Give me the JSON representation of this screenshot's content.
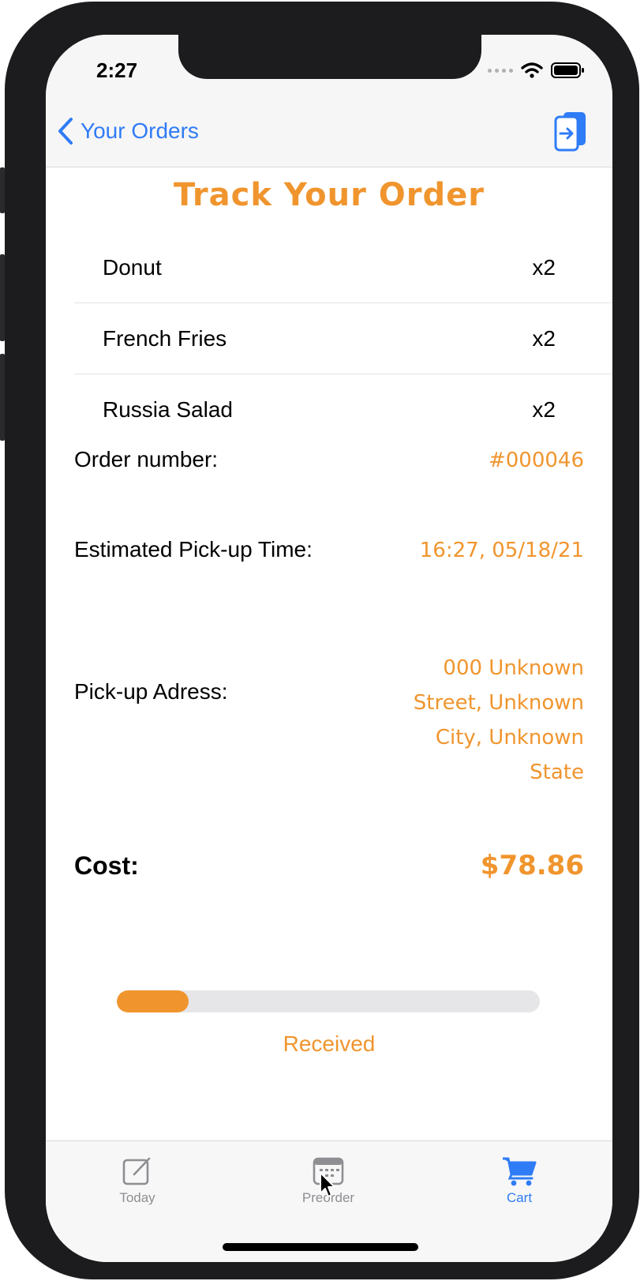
{
  "status_bar": {
    "time": "2:27"
  },
  "nav": {
    "back_label": "Your Orders"
  },
  "page": {
    "title": "Track Your Order"
  },
  "order_items": [
    {
      "name": "Donut",
      "qty": "x2"
    },
    {
      "name": "French Fries",
      "qty": "x2"
    },
    {
      "name": "Russia Salad",
      "qty": "x2"
    }
  ],
  "details": {
    "order_number_label": "Order number:",
    "order_number_value": "#000046",
    "pickup_time_label": "Estimated Pick-up Time:",
    "pickup_time_value": "16:27, 05/18/21",
    "pickup_address_label": "Pick-up Adress:",
    "pickup_address_value": "000 Unknown Street, Unknown City, Unknown State",
    "cost_label": "Cost:",
    "cost_value": "$78.86"
  },
  "progress": {
    "fraction": 0.17,
    "status": "Received"
  },
  "tabbar": {
    "tabs": [
      {
        "label": "Today",
        "icon": "compose-icon",
        "active": false
      },
      {
        "label": "Preorder",
        "icon": "calendar-icon",
        "active": false
      },
      {
        "label": "Cart",
        "icon": "cart-icon",
        "active": true
      }
    ]
  },
  "colors": {
    "accent": "#f0952e",
    "link": "#2f7cf6",
    "inactive": "#8e8e93"
  }
}
